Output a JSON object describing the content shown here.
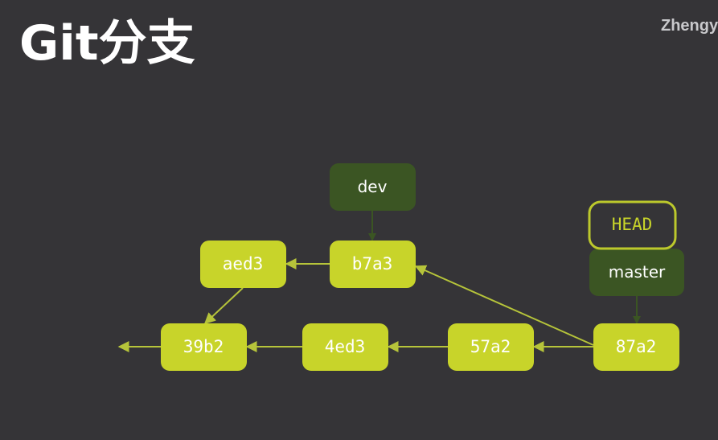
{
  "slide": {
    "title": "Git分支",
    "watermark": "Zhengy"
  },
  "colors": {
    "background": "#353437",
    "commit_fill": "#c8d42a",
    "branch_fill": "#3b5523",
    "head_stroke": "#bcc82c",
    "arrow": "#b6c43a",
    "text": "#ffffff"
  },
  "graph": {
    "commits": [
      {
        "id": "87a2",
        "label": "87a2"
      },
      {
        "id": "57a2",
        "label": "57a2"
      },
      {
        "id": "4ed3",
        "label": "4ed3"
      },
      {
        "id": "39b2",
        "label": "39b2"
      },
      {
        "id": "b7a3",
        "label": "b7a3"
      },
      {
        "id": "aed3",
        "label": "aed3"
      }
    ],
    "branches": [
      {
        "id": "dev",
        "label": "dev",
        "points_to": "b7a3"
      },
      {
        "id": "master",
        "label": "master",
        "points_to": "87a2"
      }
    ],
    "head": {
      "label": "HEAD",
      "points_to": "master"
    },
    "parent_links": [
      {
        "from": "87a2",
        "to": "57a2"
      },
      {
        "from": "87a2",
        "to": "b7a3"
      },
      {
        "from": "57a2",
        "to": "4ed3"
      },
      {
        "from": "4ed3",
        "to": "39b2"
      },
      {
        "from": "b7a3",
        "to": "aed3"
      },
      {
        "from": "aed3",
        "to": "39b2"
      },
      {
        "from": "39b2",
        "to": "earlier"
      }
    ]
  }
}
